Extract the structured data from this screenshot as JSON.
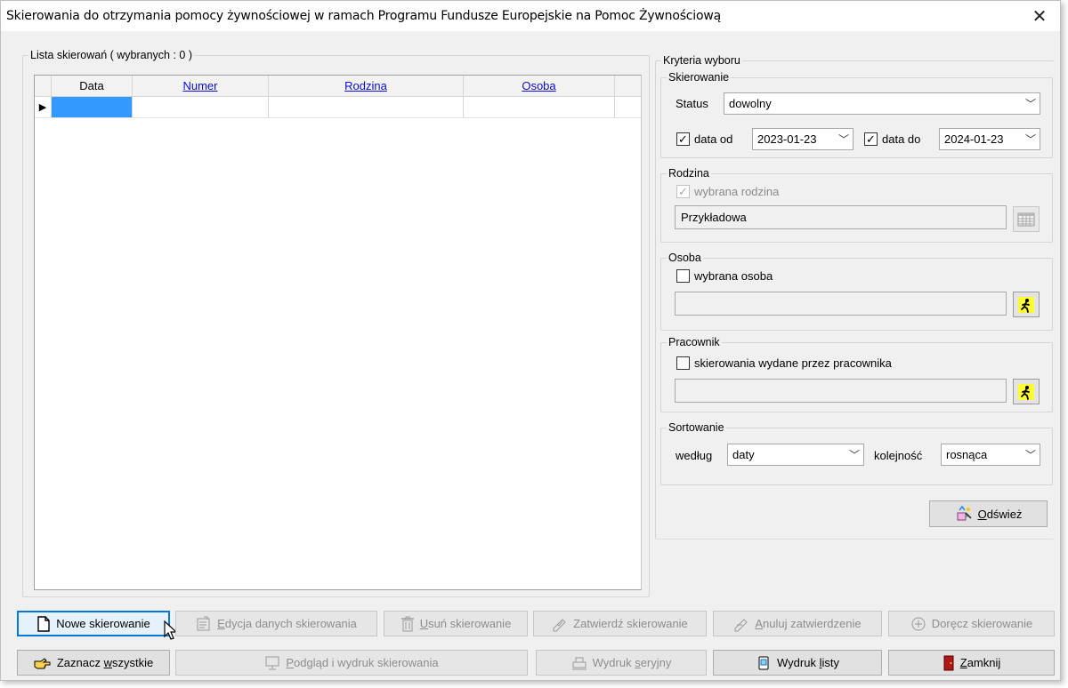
{
  "window": {
    "title": "Skierowania do otrzymania pomocy żywnościowej w ramach Programu Fundusze Europejskie na Pomoc Żywnościową",
    "close_glyph": "✕"
  },
  "list": {
    "group_label": "Lista skierowań ( wybranych : 0 )",
    "columns": [
      "Data",
      "Numer",
      "Rodzina",
      "Osoba"
    ]
  },
  "criteria": {
    "group_label": "Kryteria wyboru",
    "skierowanie": {
      "label": "Skierowanie",
      "status_label": "Status",
      "status_value": "dowolny",
      "date_from_label": "data od",
      "date_from_checked": true,
      "date_from": "2023-01-23",
      "date_to_label": "data do",
      "date_to_checked": true,
      "date_to": "2024-01-23"
    },
    "rodzina": {
      "label": "Rodzina",
      "checkbox_label": "wybrana rodzina",
      "checked": true,
      "value": "Przykładowa"
    },
    "osoba": {
      "label": "Osoba",
      "checkbox_label": "wybrana osoba",
      "checked": false,
      "value": ""
    },
    "pracownik": {
      "label": "Pracownik",
      "checkbox_label": "skierowania wydane przez pracownika",
      "checked": false,
      "value": ""
    },
    "sortowanie": {
      "label": "Sortowanie",
      "by_label": "według",
      "by_value": "daty",
      "order_label": "kolejność",
      "order_value": "rosnąca"
    },
    "refresh_label": "Odśwież"
  },
  "buttons_row1": {
    "new": "Nowe skierowanie",
    "edit": "Edycja danych skierowania",
    "delete": "Usuń skierowanie",
    "approve": "Zatwierdź skierowanie",
    "cancel_approval": "Anuluj zatwierdzenie",
    "deliver": "Doręcz skierowanie"
  },
  "buttons_row2": {
    "select_all": "Zaznacz wszystkie",
    "preview": "Podgląd i wydruk skierowania",
    "serial_print": "Wydruk seryjny",
    "list_print": "Wydruk listy",
    "close": "Zamknij"
  },
  "colors": {
    "selection": "#3399ff",
    "link": "#0b0bd8",
    "focus": "#0078d7",
    "disabled_text": "#8d8d8d"
  }
}
